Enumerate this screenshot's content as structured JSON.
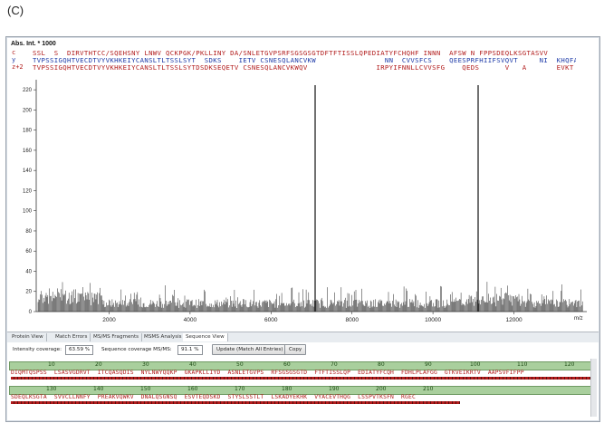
{
  "panel_label": "(C)",
  "spectrum": {
    "y_axis_title": "Abs. Int. * 1000",
    "x_axis_unit": "m/z",
    "y_ticks": [
      "0",
      "20",
      "40",
      "60",
      "80",
      "100",
      "120",
      "140",
      "160",
      "180",
      "200",
      "220"
    ],
    "x_ticks": [
      "2000",
      "4000",
      "6000",
      "8000",
      "10000",
      "12000"
    ],
    "seq_c": "SSL  S  DIRVTHTCC/SQEHSNY LNWV QCKPGK/PKLLINY DA/SNLETGVPSRFSGSGSGTDFTFTISSLQPEDIATYFCHQHF INNN  AFSW N FPPSDEQLKSGTASVV",
    "seq_y": "TVPSSIGQHTVECDTVYVKHKEIYCANSLTLTSSLSYT  SDKS    IETV CSNESQLANCVKW                NN  CVVSFCS    QEESPRFHIIFSVQVT     NI  KHQFALPLHH  QC",
    "seq_z": "TVPSSIGQHTVECDTVYVKHKEIYCANSLTLTSSLSYTDSDKSEQETV CSNESQLANCVKWQV                IRPYIFNNLLCVVSFG    QEDS      V   A       EVKT QFALPLHHD",
    "left_tags": [
      "c",
      "y",
      "z+2"
    ]
  },
  "tabs": [
    "Protein View",
    "Match Errors",
    "MS/MS Fragments",
    "MSMS Analysis",
    "Sequence View"
  ],
  "coverage": {
    "intensity_label": "Intensity coverage:",
    "intensity_value": "63.59 %",
    "sequence_label": "Sequence coverage MS/MS:",
    "sequence_value": "91.1 %",
    "update_button": "Update (Match All Entries)",
    "copy_button": "Copy"
  },
  "sequence_view": {
    "ruler1": [
      "10",
      "20",
      "30",
      "40",
      "50",
      "60",
      "70",
      "80",
      "90",
      "100",
      "110",
      "120"
    ],
    "line1": "DIQMTQSPSS  LSASVGDRVT  ITCQASQDIS  NYLNWYQQKP  GKAPKLLIYD  ASNLETGVPS  RFSGSGSGTD  FTFTISSLQP  EDIATYFCQH  FDHLPLAFGG  GTKVEIKRTV  AAPSVFIFPP",
    "ruler2": [
      "130",
      "140",
      "150",
      "160",
      "170",
      "180",
      "190",
      "200",
      "210"
    ],
    "line2": "SDEQLKSGTA  SVVCLLNNFY  PREAKVQWKV  DNALQSGNSQ  ESVTEQDSKD  STYSLSSTLT  LSKADYEKHK  VYACEVTHQG  LSSPVTKSFN  RGEC"
  }
}
